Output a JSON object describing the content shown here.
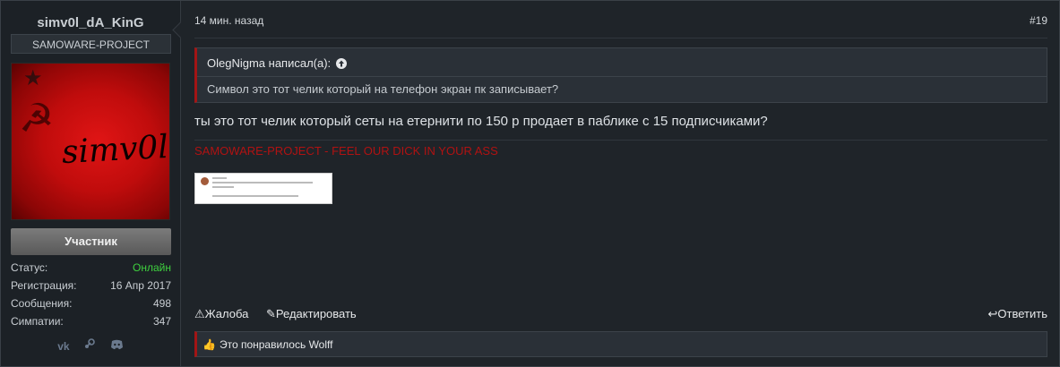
{
  "user": {
    "name": "simv0l_dA_KinG",
    "title": "SAMOWARE-PROJECT",
    "avatar_text": "simv0l",
    "role": "Участник",
    "stats": [
      {
        "label": "Статус:",
        "value": "Онлайн"
      },
      {
        "label": "Регистрация:",
        "value": "16 Апр 2017"
      },
      {
        "label": "Сообщения:",
        "value": "498"
      },
      {
        "label": "Симпатии:",
        "value": "347"
      }
    ],
    "contacts": [
      "vk-icon",
      "steam-icon",
      "discord-icon"
    ]
  },
  "post": {
    "time": "14 мин. назад",
    "number": "#19",
    "quote_author": "OlegNigma написал(а):",
    "quote_text": "Символ это тот челик который на телефон экран пк записывает?",
    "message": "ты это тот челик который сеты на етернити по 150 р продает в паблике с 15 подписчиками?",
    "signature": "SAMOWARE-PROJECT - FEEL OUR DICK IN YOUR ASS"
  },
  "actions": {
    "report": "Жалоба",
    "edit": "Редактировать",
    "reply": "Ответить"
  },
  "likes": {
    "text": "Это понравилось Wolff"
  },
  "colors": {
    "accent_red": "#a31515",
    "online_green": "#3fd13f",
    "background": "#1f2429"
  }
}
